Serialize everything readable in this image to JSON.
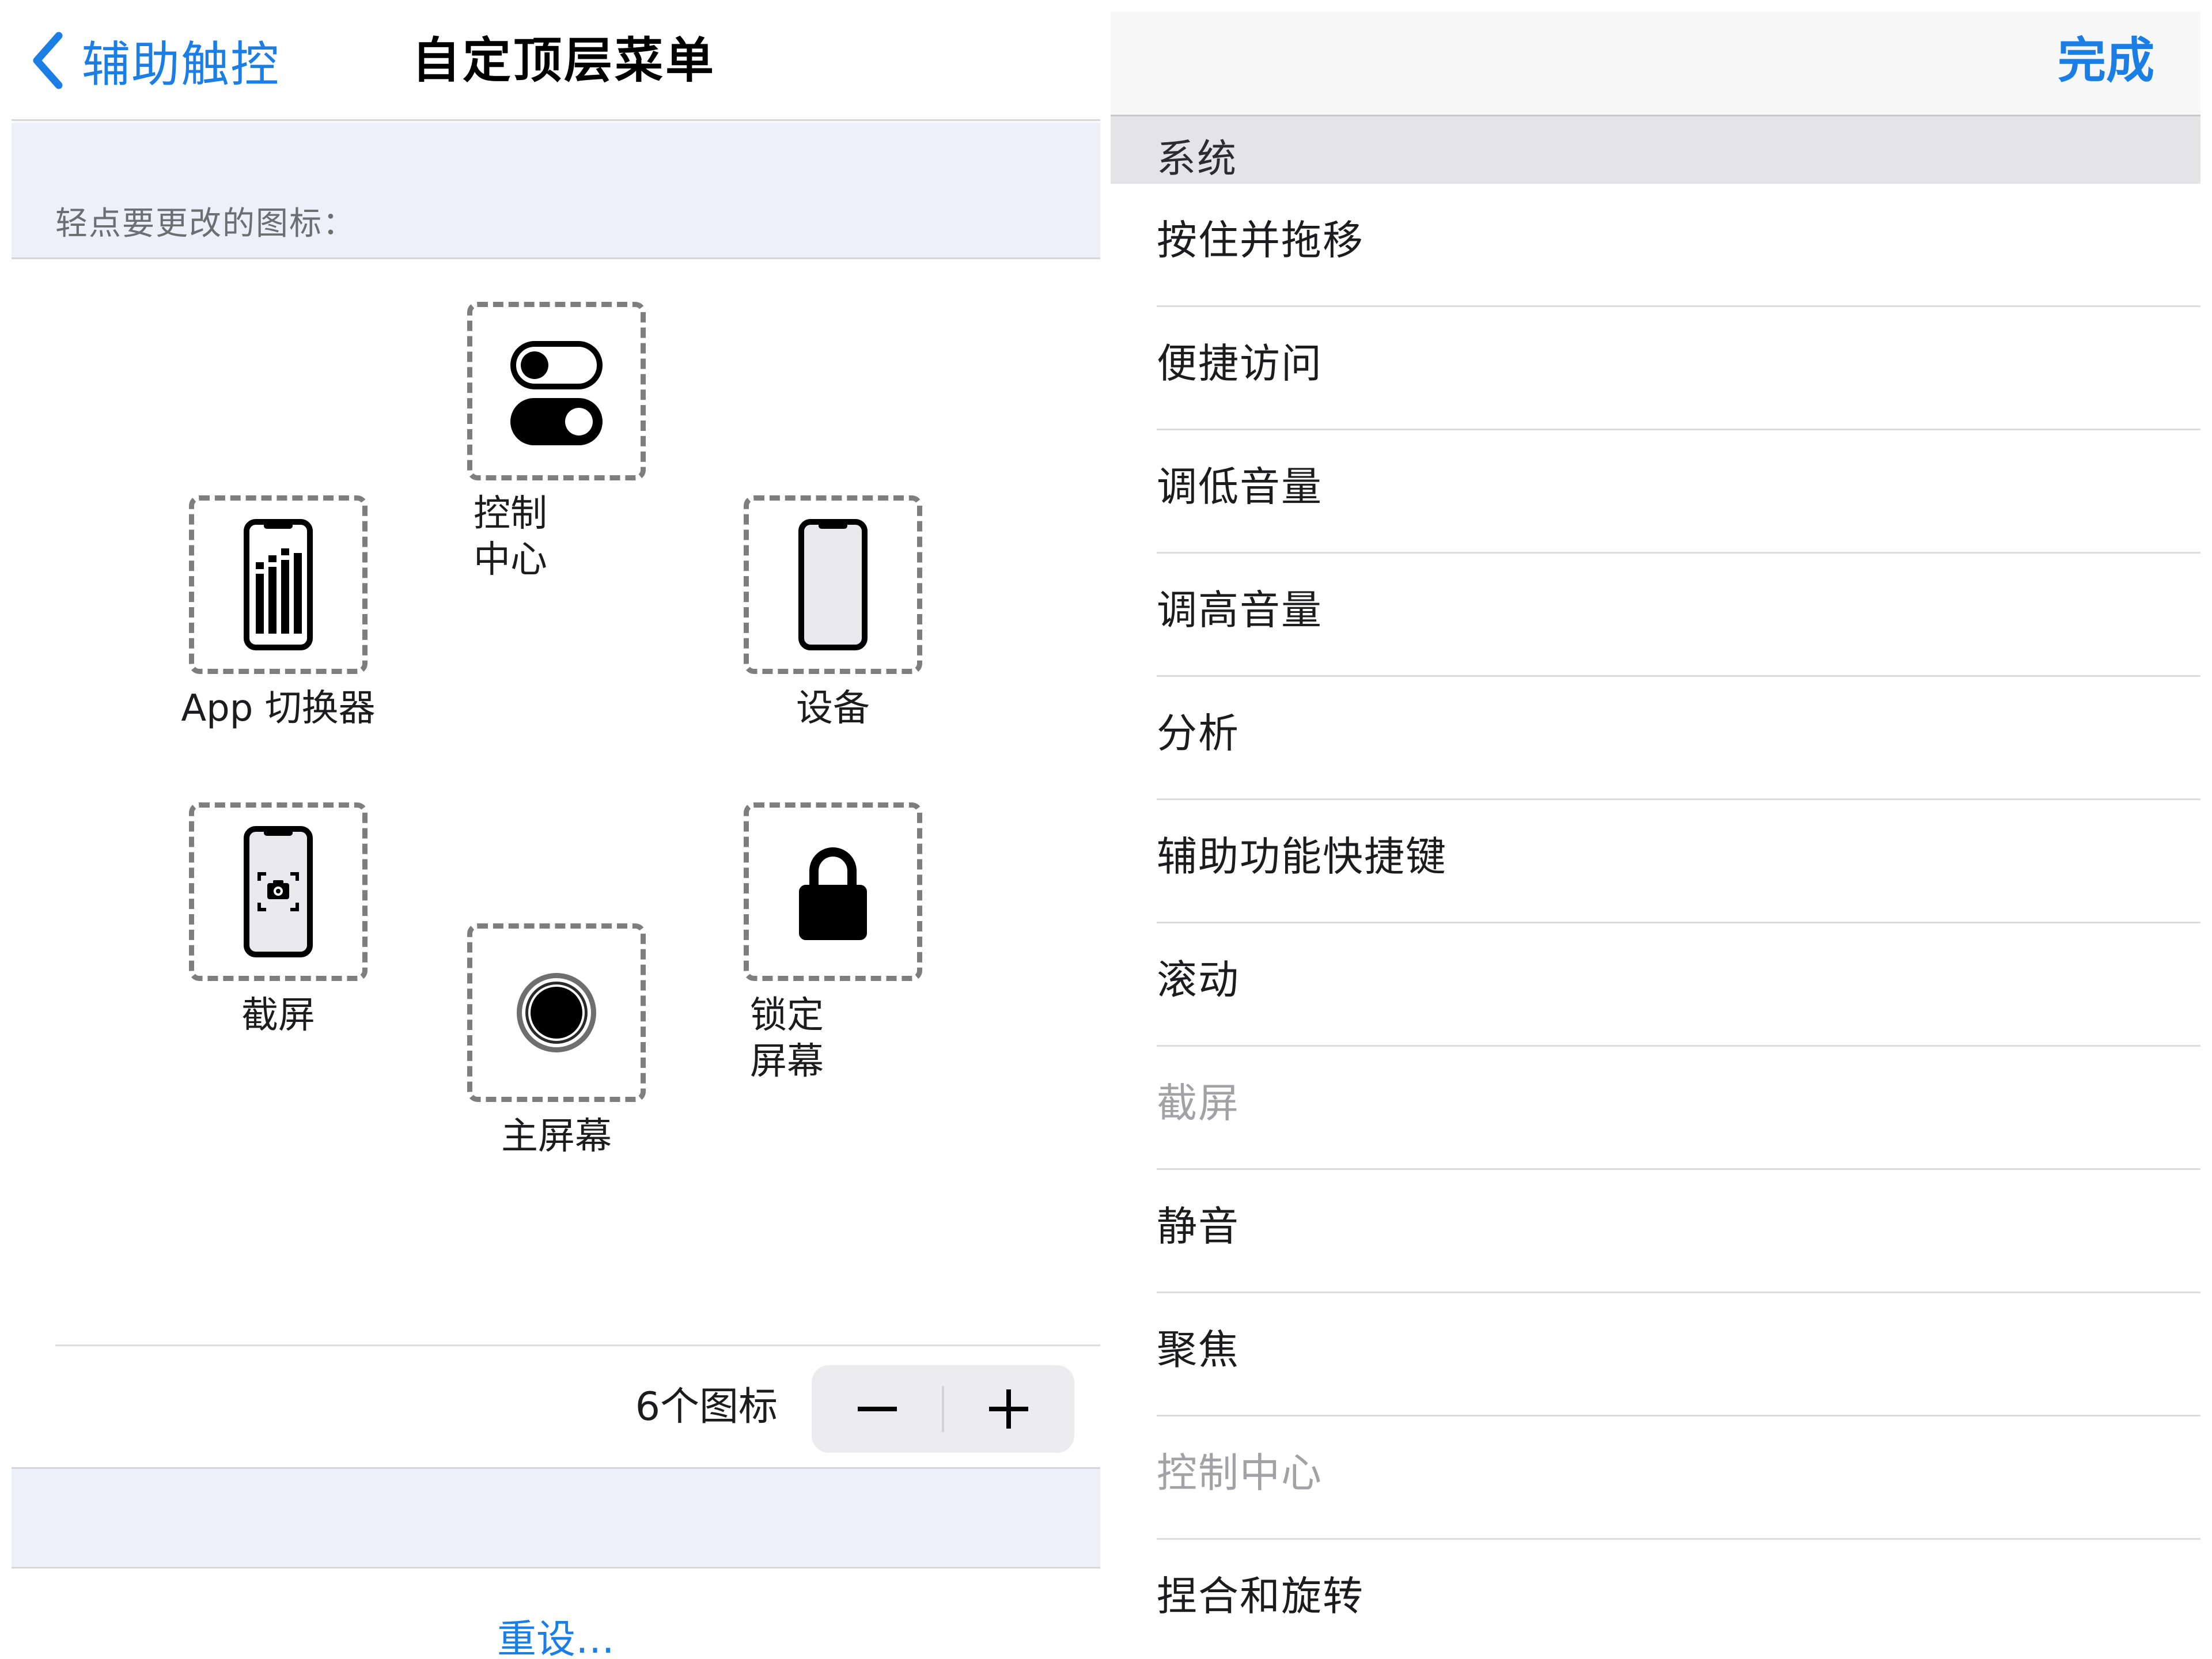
{
  "left": {
    "nav": {
      "back_label": "辅助触控",
      "title": "自定顶层菜单"
    },
    "hint": "轻点要更改的图标：",
    "slots": {
      "control": {
        "label_line1": "控制",
        "label_line2": "中心",
        "icon": "toggle-switches-icon"
      },
      "app": {
        "label": "App 切换器",
        "icon": "app-switcher-icon"
      },
      "device": {
        "label": "设备",
        "icon": "iphone-device-icon"
      },
      "shot": {
        "label": "截屏",
        "icon": "screenshot-icon"
      },
      "home": {
        "label": "主屏幕",
        "icon": "home-button-icon"
      },
      "lock": {
        "label_line1": "锁定",
        "label_line2": "屏幕",
        "icon": "lock-icon"
      }
    },
    "count_label": "6个图标",
    "stepper": {
      "minus_icon": "minus-icon",
      "plus_icon": "plus-icon"
    },
    "reset_label": "重设…"
  },
  "right": {
    "done_label": "完成",
    "section_title": "系统",
    "items": [
      {
        "label": "按住并拖移",
        "enabled": true
      },
      {
        "label": "便捷访问",
        "enabled": true
      },
      {
        "label": "调低音量",
        "enabled": true
      },
      {
        "label": "调高音量",
        "enabled": true
      },
      {
        "label": "分析",
        "enabled": true
      },
      {
        "label": "辅助功能快捷键",
        "enabled": true
      },
      {
        "label": "滚动",
        "enabled": true
      },
      {
        "label": "截屏",
        "enabled": false
      },
      {
        "label": "静音",
        "enabled": true
      },
      {
        "label": "聚焦",
        "enabled": true
      },
      {
        "label": "控制中心",
        "enabled": false
      },
      {
        "label": "捏合和旋转",
        "enabled": true
      }
    ]
  },
  "colors": {
    "accent": "#1a7ee5",
    "grouped_bg": "#eeeff8",
    "disabled_text": "#a1a1a6"
  }
}
